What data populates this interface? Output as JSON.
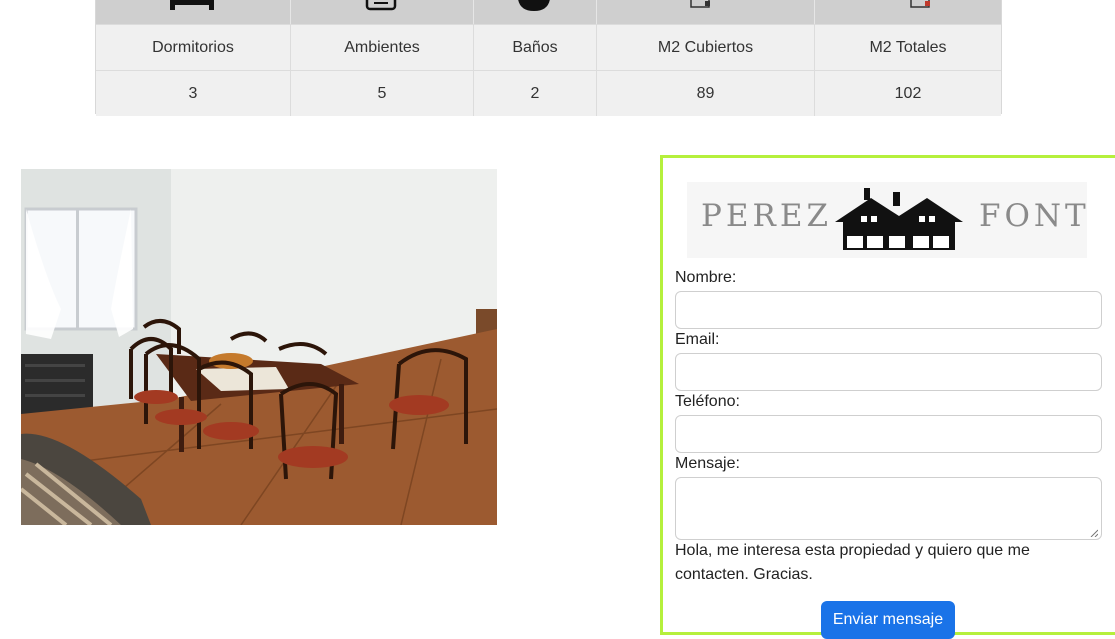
{
  "features": {
    "icons": [
      "bed-icon",
      "swap-icon",
      "bathtub-icon",
      "area-icon",
      "area-total-icon"
    ],
    "labels": [
      "Dormitorios",
      "Ambientes",
      "Baños",
      "M2 Cubiertos",
      "M2 Totales"
    ],
    "values": [
      "3",
      "5",
      "2",
      "89",
      "102"
    ]
  },
  "photo": {
    "subject": "dining-room-photo"
  },
  "contact": {
    "logo": {
      "left": "PEREZ",
      "right": "FONT"
    },
    "name_label": "Nombre:",
    "email_label": "Email:",
    "phone_label": "Teléfono:",
    "message_label": "Mensaje:",
    "message_text": "Hola, me interesa esta propiedad y quiero que me contacten. Gracias.",
    "submit_label": "Enviar mensaje"
  },
  "colors": {
    "accent_border": "#b5f03c",
    "button": "#1a73e8"
  }
}
